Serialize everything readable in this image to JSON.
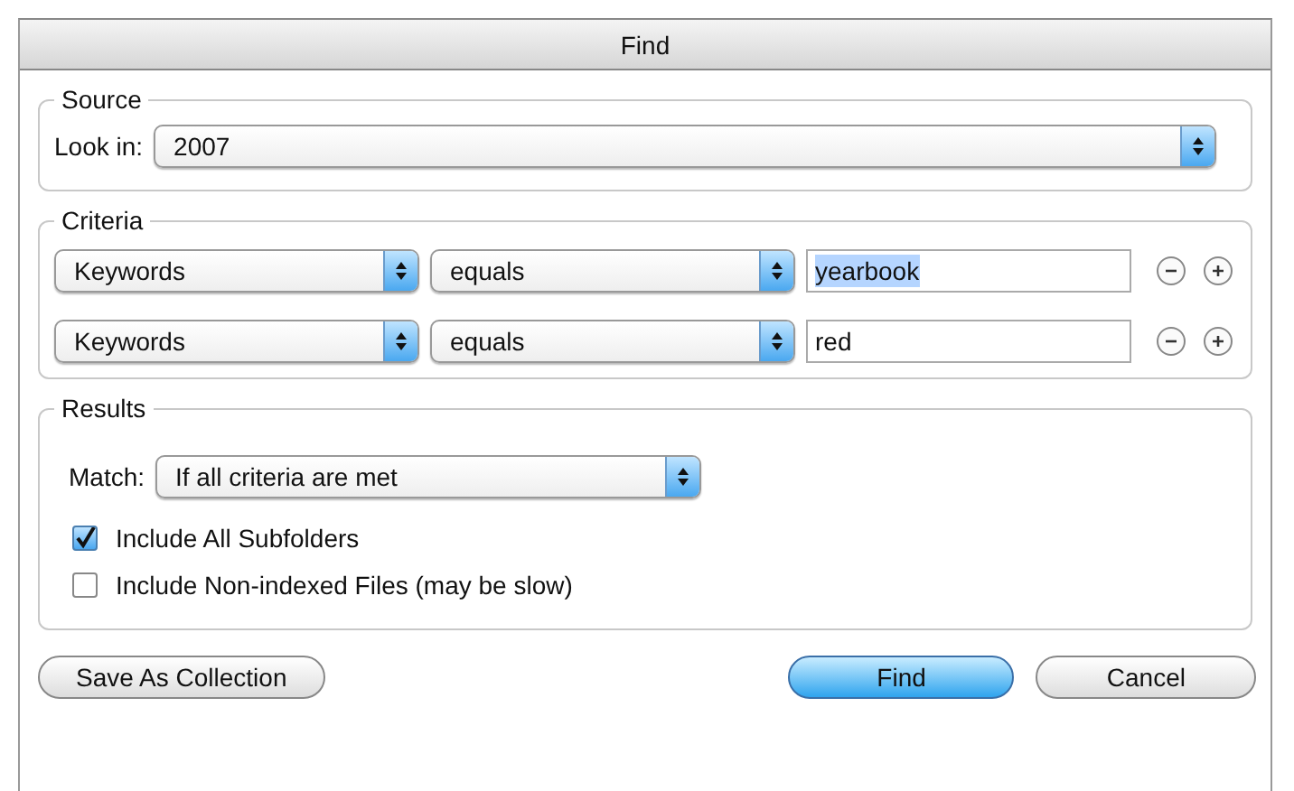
{
  "window": {
    "title": "Find"
  },
  "source": {
    "title": "Source",
    "look_in_label": "Look in:",
    "look_in_value": "2007"
  },
  "criteria": {
    "title": "Criteria",
    "rows": [
      {
        "field": "Keywords",
        "operator": "equals",
        "value": "yearbook",
        "text_selected": true
      },
      {
        "field": "Keywords",
        "operator": "equals",
        "value": "red",
        "text_selected": false
      }
    ]
  },
  "results": {
    "title": "Results",
    "match_label": "Match:",
    "match_value": "If all criteria are met",
    "options": [
      {
        "label": "Include All Subfolders",
        "checked": true
      },
      {
        "label": "Include Non-indexed Files (may be slow)",
        "checked": false
      }
    ]
  },
  "buttons": [
    {
      "label": "Save As Collection",
      "default": false
    },
    {
      "label": "Find",
      "default": true
    },
    {
      "label": "Cancel",
      "default": false
    }
  ]
}
